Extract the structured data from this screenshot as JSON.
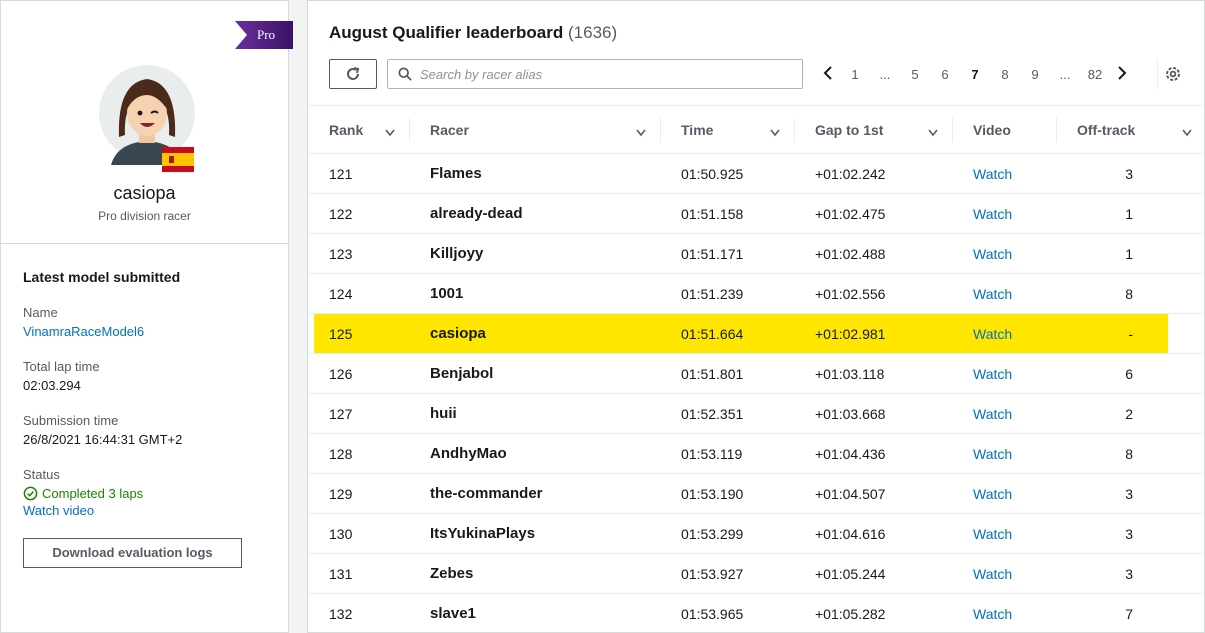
{
  "profile": {
    "badge": "Pro",
    "username": "casiopa",
    "division": "Pro division racer",
    "country_flag": "spain-flag"
  },
  "model": {
    "section_title": "Latest model submitted",
    "name_label": "Name",
    "name_value": "VinamraRaceModel6",
    "lap_label": "Total lap time",
    "lap_value": "02:03.294",
    "submission_label": "Submission time",
    "submission_value": "26/8/2021 16:44:31 GMT+2",
    "status_label": "Status",
    "status_value": "Completed 3 laps",
    "watch_video": "Watch video",
    "download_button": "Download evaluation logs"
  },
  "leaderboard": {
    "title": "August Qualifier leaderboard",
    "count": "(1636)",
    "search_placeholder": "Search by racer alias",
    "pages": [
      "1",
      "...",
      "5",
      "6",
      "7",
      "8",
      "9",
      "...",
      "82"
    ],
    "current_page": "7",
    "columns": [
      "Rank",
      "Racer",
      "Time",
      "Gap to 1st",
      "Video",
      "Off-track"
    ],
    "rows": [
      {
        "rank": "121",
        "racer": "Flames",
        "time": "01:50.925",
        "gap": "+01:02.242",
        "video": "Watch",
        "off": "3"
      },
      {
        "rank": "122",
        "racer": "already-dead",
        "time": "01:51.158",
        "gap": "+01:02.475",
        "video": "Watch",
        "off": "1"
      },
      {
        "rank": "123",
        "racer": "Killjoyy",
        "time": "01:51.171",
        "gap": "+01:02.488",
        "video": "Watch",
        "off": "1"
      },
      {
        "rank": "124",
        "racer": "1001",
        "time": "01:51.239",
        "gap": "+01:02.556",
        "video": "Watch",
        "off": "8"
      },
      {
        "rank": "125",
        "racer": "casiopa",
        "time": "01:51.664",
        "gap": "+01:02.981",
        "video": "Watch",
        "off": "-",
        "highlight": true
      },
      {
        "rank": "126",
        "racer": "Benjabol",
        "time": "01:51.801",
        "gap": "+01:03.118",
        "video": "Watch",
        "off": "6"
      },
      {
        "rank": "127",
        "racer": "huii",
        "time": "01:52.351",
        "gap": "+01:03.668",
        "video": "Watch",
        "off": "2"
      },
      {
        "rank": "128",
        "racer": "AndhyMao",
        "time": "01:53.119",
        "gap": "+01:04.436",
        "video": "Watch",
        "off": "8"
      },
      {
        "rank": "129",
        "racer": "the-commander",
        "time": "01:53.190",
        "gap": "+01:04.507",
        "video": "Watch",
        "off": "3"
      },
      {
        "rank": "130",
        "racer": "ItsYukinaPlays",
        "time": "01:53.299",
        "gap": "+01:04.616",
        "video": "Watch",
        "off": "3"
      },
      {
        "rank": "131",
        "racer": "Zebes",
        "time": "01:53.927",
        "gap": "+01:05.244",
        "video": "Watch",
        "off": "3"
      },
      {
        "rank": "132",
        "racer": "slave1",
        "time": "01:53.965",
        "gap": "+01:05.282",
        "video": "Watch",
        "off": "7"
      }
    ]
  },
  "colors": {
    "highlight": "#ffe600",
    "link": "#0073bb",
    "success": "#1d8102",
    "pro_badge": "#4b1a7f"
  }
}
